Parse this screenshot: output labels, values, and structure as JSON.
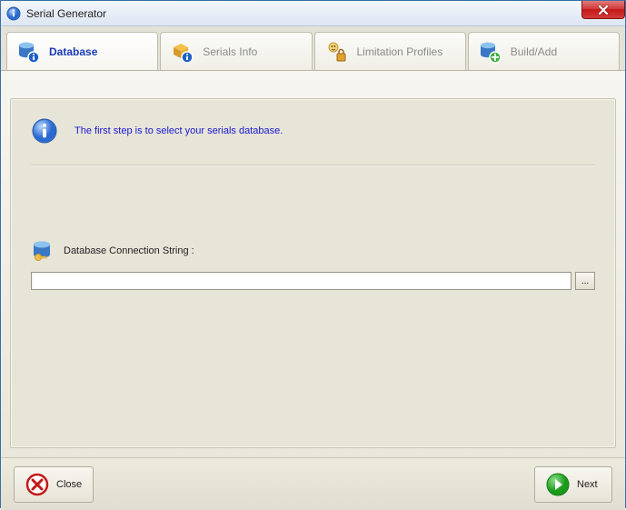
{
  "window": {
    "title": "Serial Generator"
  },
  "tabs": [
    {
      "label": "Database"
    },
    {
      "label": "Serials Info"
    },
    {
      "label": "Limitation Profiles"
    },
    {
      "label": "Build/Add"
    }
  ],
  "info": {
    "message": "The first step is to select your serials database."
  },
  "connection": {
    "label": "Database Connection String :",
    "value": "",
    "placeholder": "",
    "browse_label": "..."
  },
  "footer": {
    "close_label": "Close",
    "next_label": "Next"
  }
}
